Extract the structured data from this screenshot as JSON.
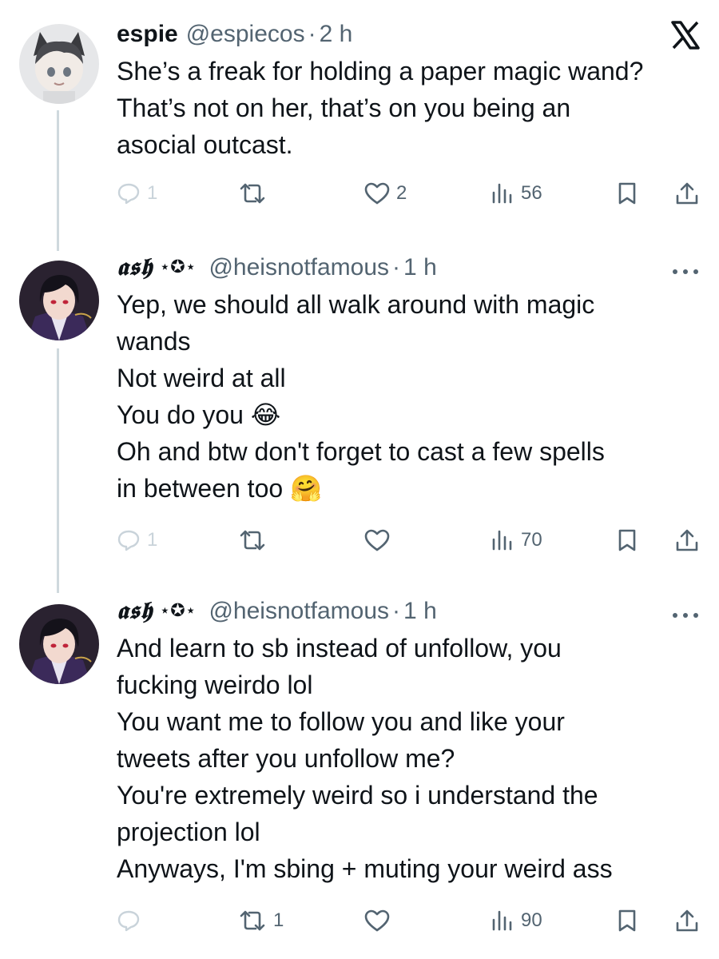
{
  "tweets": [
    {
      "name": "espie",
      "handle": "@espiecos",
      "dot": "·",
      "time": "2 h",
      "lines": [
        "She’s a freak for holding a paper magic wand?",
        "That’s not on her, that’s on you being an",
        "asocial outcast."
      ],
      "reply_count": "1",
      "retweet_count": "",
      "like_count": "2",
      "view_count": "56"
    },
    {
      "name": "𝖆𝖘𝖍",
      "name_deco": "⋆✪⋆",
      "handle": "@heisnotfamous",
      "dot": "·",
      "time": "1 h",
      "lines": [
        "Yep, we should all walk around with magic",
        "wands",
        "Not weird at all",
        "You do you",
        "Oh and btw don't forget to cast a few spells",
        "in between too"
      ],
      "emoji_laugh": "😂",
      "emoji_hug": "🤗",
      "reply_count": "1",
      "retweet_count": "",
      "like_count": "",
      "view_count": "70"
    },
    {
      "name": "𝖆𝖘𝖍",
      "name_deco": "⋆✪⋆",
      "handle": "@heisnotfamous",
      "dot": "·",
      "time": "1 h",
      "lines": [
        "And learn to sb instead of unfollow, you",
        "fucking weirdo lol",
        "You want me to follow you and like your",
        "tweets after you unfollow me?",
        "You're extremely weird so i understand the",
        "projection lol",
        "Anyways, I'm sbing + muting your weird ass"
      ],
      "reply_count": "",
      "retweet_count": "1",
      "like_count": "",
      "view_count": "90"
    }
  ],
  "icons": {
    "reply": "reply-icon",
    "retweet": "retweet-icon",
    "like": "heart-icon",
    "views": "views-icon",
    "bookmark": "bookmark-icon",
    "share": "share-icon",
    "brand": "x-logo-icon",
    "more": "more-options-icon"
  },
  "colors": {
    "text": "#0f1419",
    "secondary": "#536471",
    "thread_line": "#cfd9de"
  }
}
